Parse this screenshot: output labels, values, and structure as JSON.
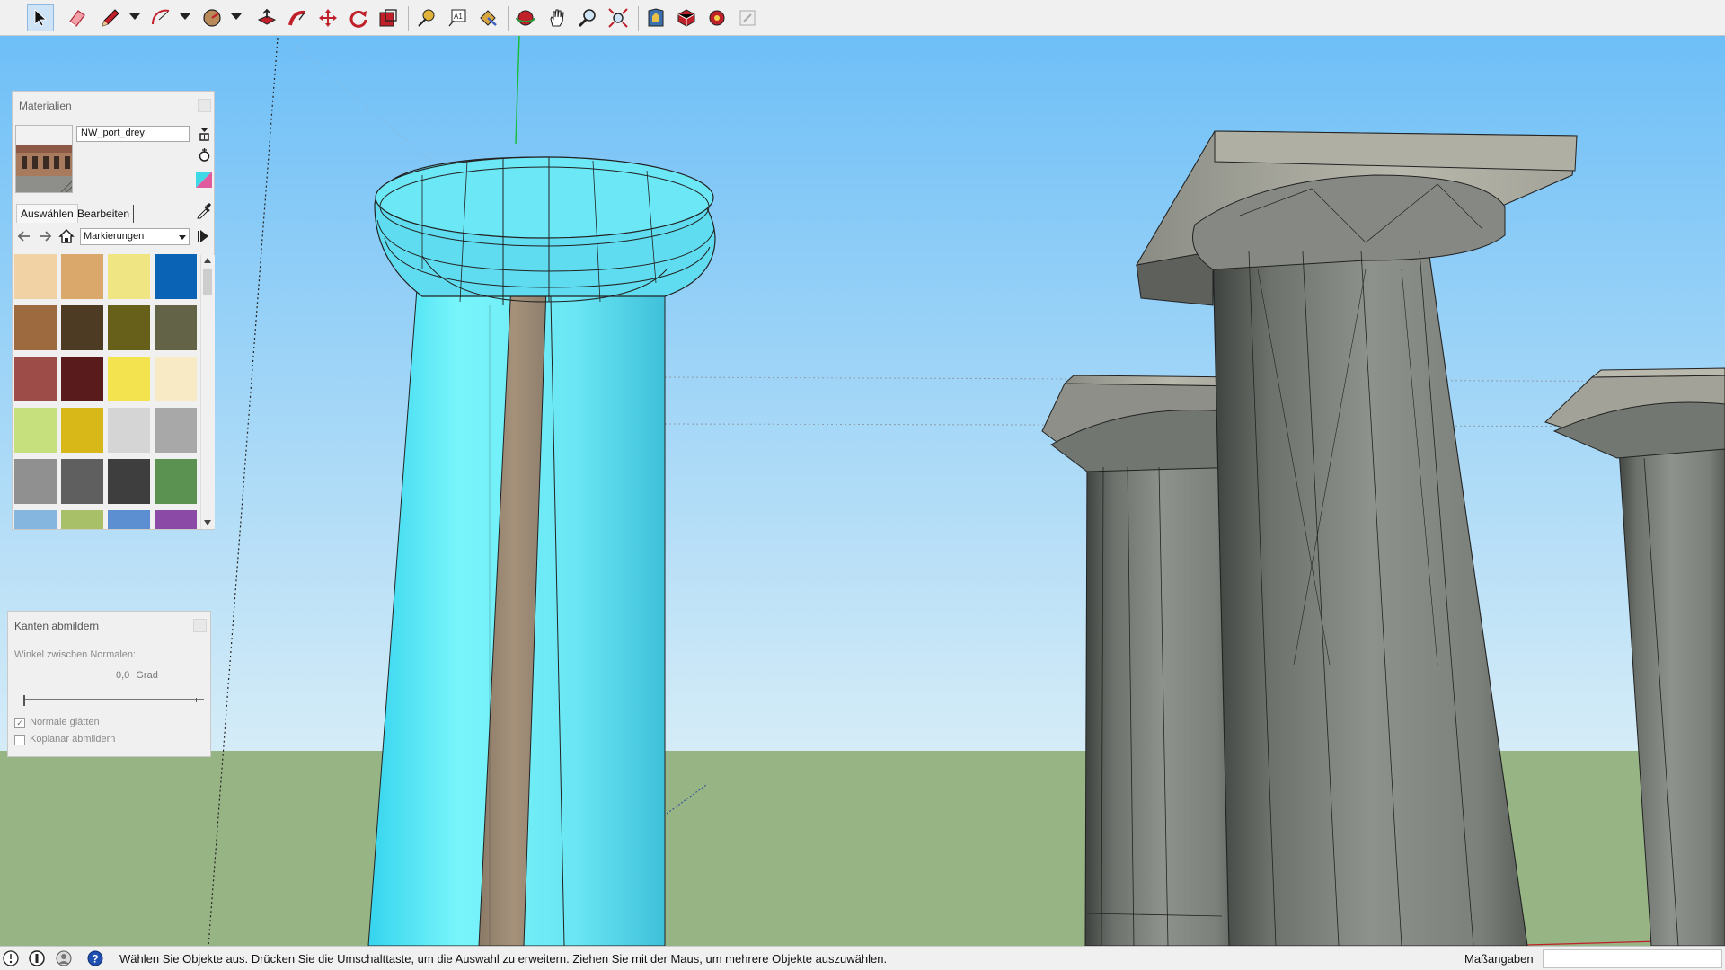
{
  "toolbar": {
    "tools": [
      {
        "name": "select-tool",
        "icon": "arrow-cursor-icon",
        "active": true
      },
      {
        "name": "eraser-tool",
        "icon": "eraser-icon"
      },
      {
        "name": "line-tool",
        "icon": "pencil-icon",
        "dropdown": true
      },
      {
        "name": "arc-tool",
        "icon": "arc-icon",
        "dropdown": true
      },
      {
        "name": "shapes-tool",
        "icon": "circle-icon",
        "dropdown": true
      },
      {
        "name": "push-pull-tool",
        "icon": "push-pull-icon"
      },
      {
        "name": "follow-me-tool",
        "icon": "follow-me-icon"
      },
      {
        "name": "move-tool",
        "icon": "move-icon"
      },
      {
        "name": "rotate-tool",
        "icon": "rotate-icon"
      },
      {
        "name": "scale-tool",
        "icon": "scale-icon"
      },
      {
        "name": "tape-measure-tool",
        "icon": "tape-measure-icon"
      },
      {
        "name": "text-tool",
        "icon": "text-icon"
      },
      {
        "name": "paint-bucket-tool",
        "icon": "paint-bucket-icon"
      },
      {
        "name": "orbit-tool",
        "icon": "orbit-icon"
      },
      {
        "name": "pan-tool",
        "icon": "hand-icon"
      },
      {
        "name": "zoom-tool",
        "icon": "zoom-icon"
      },
      {
        "name": "zoom-extents-tool",
        "icon": "zoom-extents-icon"
      },
      {
        "name": "3d-warehouse-button",
        "icon": "warehouse-icon"
      },
      {
        "name": "extension-warehouse-button",
        "icon": "extension-icon"
      },
      {
        "name": "extension-manager-button",
        "icon": "gear-extension-icon"
      },
      {
        "name": "send-to-layout-button",
        "icon": "layout-icon"
      }
    ]
  },
  "materials_panel": {
    "title": "Materialien",
    "material_name": "NW_port_drey",
    "tabs": [
      "Auswählen",
      "Bearbeiten"
    ],
    "library": "Markierungen",
    "swatches": [
      "#f0d2a4",
      "#d9a86a",
      "#efe583",
      "#0a63b5",
      "#9d6a3f",
      "#4e3b24",
      "#66601a",
      "#636447",
      "#9e4c48",
      "#5a1b1c",
      "#f2e34f",
      "#f7eac4",
      "#c7e07e",
      "#d8b719",
      "#d5d5d5",
      "#a8a8a8",
      "#909090",
      "#5f5f5f",
      "#3e3e3e",
      "#5b9251",
      "#84b6e0",
      "#a8c068",
      "#5b8fd2",
      "#8a4aa5"
    ]
  },
  "soften_panel": {
    "title": "Kanten abmildern",
    "angle_label": "Winkel zwischen Normalen:",
    "angle_value": "0,0",
    "angle_unit": "Grad",
    "angle_fraction": 0.0,
    "smooth_normals_label": "Normale glätten",
    "smooth_normals_checked": true,
    "soften_coplanar_label": "Koplanar abmildern",
    "soften_coplanar_checked": false
  },
  "statusbar": {
    "message": "Wählen Sie Objekte aus. Drücken Sie die Umschalttaste, um die Auswahl zu erweitern. Ziehen Sie mit der Maus, um mehrere Objekte auszuwählen.",
    "measurements_label": "Maßangaben",
    "measurements_value": ""
  },
  "colors": {
    "sky_top": "#6ebff7",
    "sky_bottom": "#d5ecf7",
    "ground": "#97b485",
    "selected_column": "#6ee8f2",
    "stone_column": "#858883"
  }
}
